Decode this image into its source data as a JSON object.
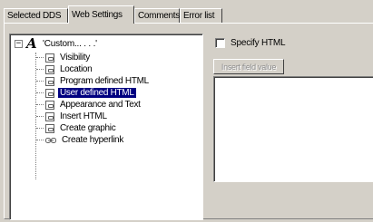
{
  "tabs": [
    "Selected DDS",
    "Web Settings",
    "Comments",
    "Error list"
  ],
  "tree": {
    "root": {
      "label": "'Custom... . . .'",
      "expander": "−"
    },
    "items": [
      "Visibility",
      "Location",
      "Program defined HTML",
      "User defined HTML",
      "Appearance and Text",
      "Insert HTML",
      "Create graphic",
      "Create hyperlink"
    ]
  },
  "specify_html": {
    "label": "Specify HTML",
    "checked": false
  },
  "insert_field_value": {
    "label": "Insert field value",
    "enabled": false
  },
  "html_text": ""
}
